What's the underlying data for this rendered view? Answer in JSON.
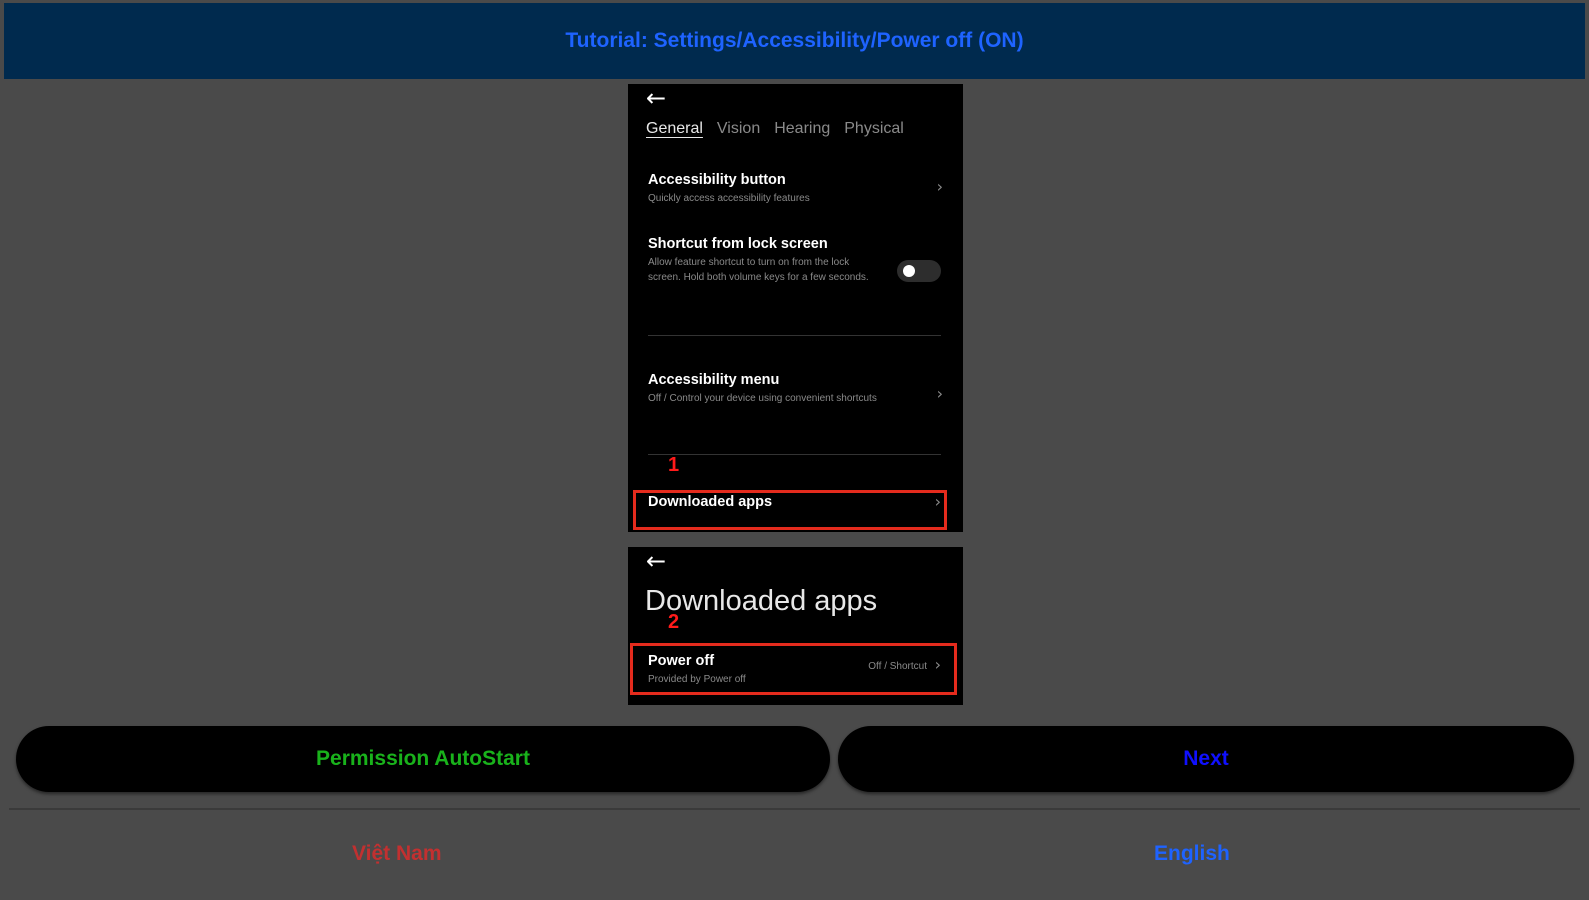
{
  "header": {
    "title": "Tutorial: Settings/Accessibility/Power off (ON)"
  },
  "screenshot1": {
    "back_icon": "back-arrow-icon",
    "tabs": [
      "General",
      "Vision",
      "Hearing",
      "Physical"
    ],
    "active_tab": "General",
    "rows": [
      {
        "title": "Accessibility button",
        "subtitle": "Quickly access accessibility features"
      },
      {
        "title": "Shortcut from lock screen",
        "subtitle": "Allow feature shortcut to turn on from the lock screen. Hold both volume keys for a few seconds."
      },
      {
        "title": "Accessibility menu",
        "subtitle": "Off / Control your device using convenient shortcuts"
      },
      {
        "title": "Downloaded apps"
      }
    ],
    "step_number": "1"
  },
  "screenshot2": {
    "back_icon": "back-arrow-icon",
    "title": "Downloaded apps",
    "step_number": "2",
    "row": {
      "title": "Power off",
      "subtitle": "Provided by Power off",
      "status": "Off / Shortcut"
    }
  },
  "buttons": {
    "permission_autostart": "Permission AutoStart",
    "next": "Next"
  },
  "languages": {
    "vietnam": "Việt Nam",
    "english": "English"
  },
  "colors": {
    "header_bg": "#002a4e",
    "header_text": "#1e63ff",
    "callout": "#e52b1d",
    "autostart_text": "#19b21b",
    "next_text": "#1010ff",
    "vietnam_text": "#c23030",
    "english_text": "#1e63ff"
  }
}
